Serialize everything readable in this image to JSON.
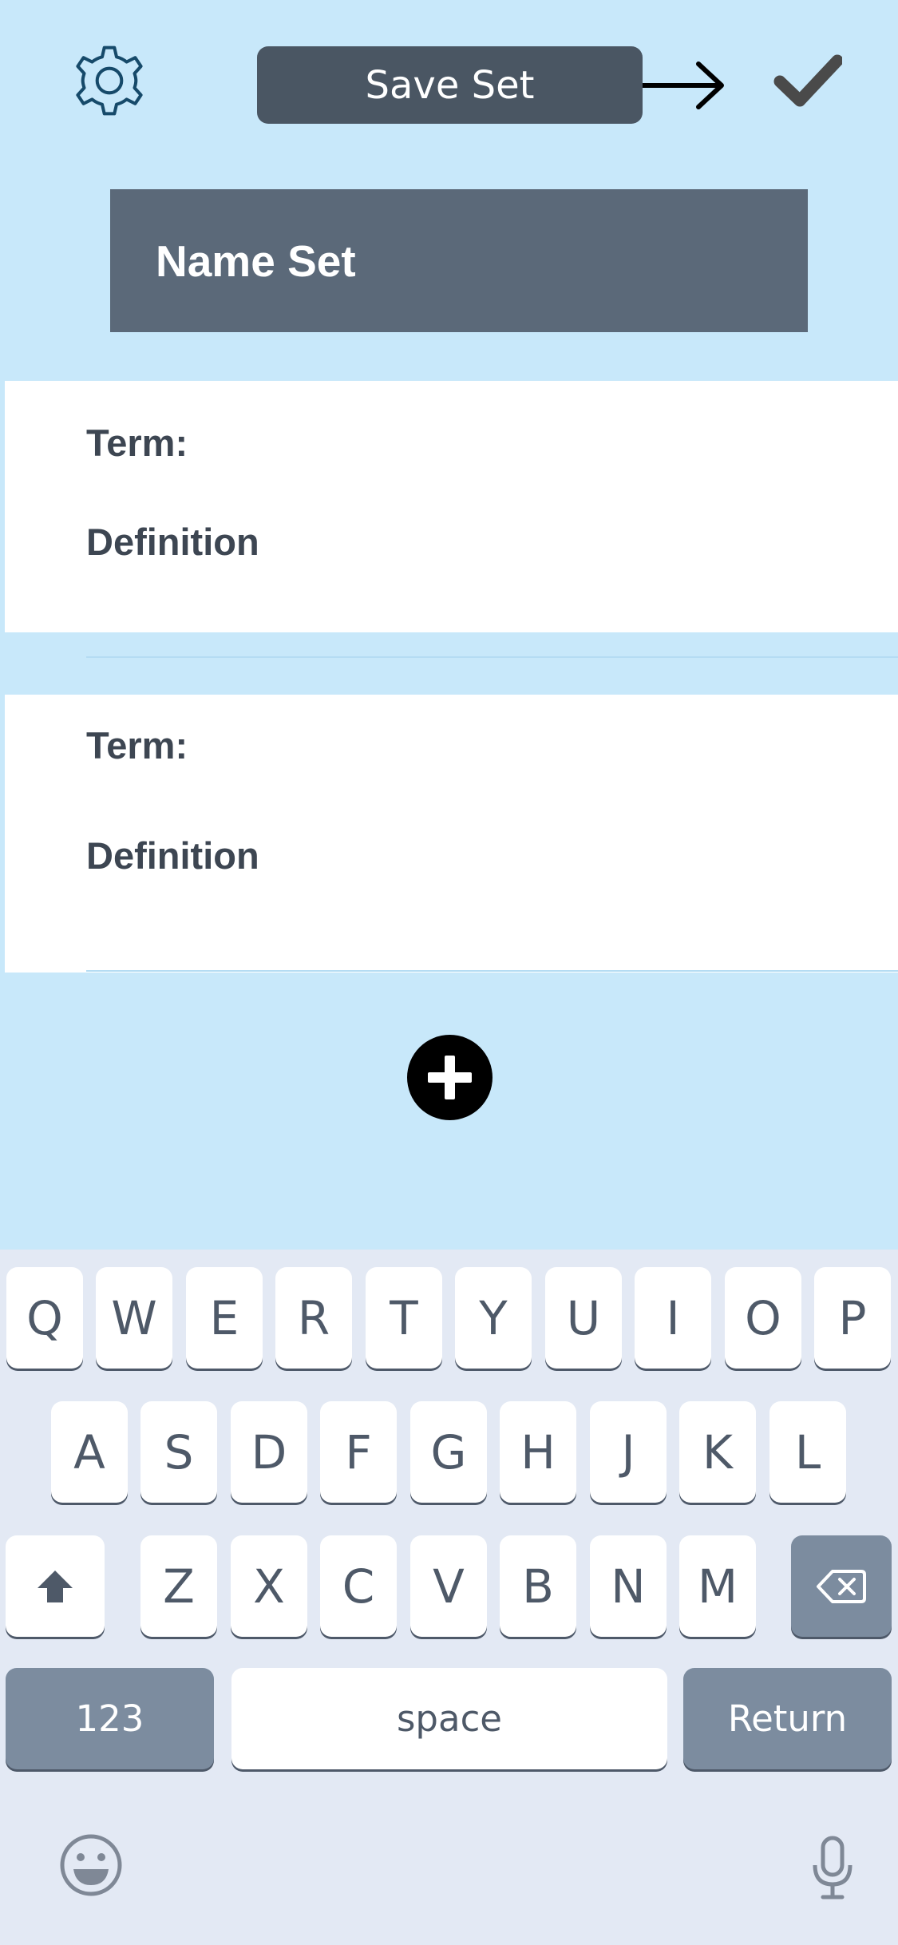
{
  "header": {
    "save_label": "Save Set"
  },
  "form": {
    "name_placeholder": "Name Set",
    "cards": [
      {
        "term_label": "Term:",
        "definition_label": "Definition"
      },
      {
        "term_label": "Term:",
        "definition_label": "Definition"
      }
    ]
  },
  "keyboard": {
    "row1": [
      "Q",
      "W",
      "E",
      "R",
      "T",
      "Y",
      "U",
      "I",
      "O",
      "P"
    ],
    "row2": [
      "A",
      "S",
      "D",
      "F",
      "G",
      "H",
      "J",
      "K",
      "L"
    ],
    "row3": [
      "Z",
      "X",
      "C",
      "V",
      "B",
      "N",
      "M"
    ],
    "numbers_label": "123",
    "space_label": "space",
    "return_label": "Return"
  },
  "colors": {
    "background": "#c8e8fa",
    "header_button": "#4a5663",
    "name_field": "#5b6979",
    "card": "#ffffff",
    "keyboard": "#e3e9f4",
    "modifier_key": "#7c8c9f"
  },
  "icons": {
    "settings": "gear-icon",
    "next": "arrow-right-icon",
    "confirm": "check-icon",
    "add": "plus-circle-icon",
    "shift": "shift-arrow-icon",
    "delete": "backspace-icon",
    "emoji": "emoji-icon",
    "dictation": "microphone-icon"
  }
}
